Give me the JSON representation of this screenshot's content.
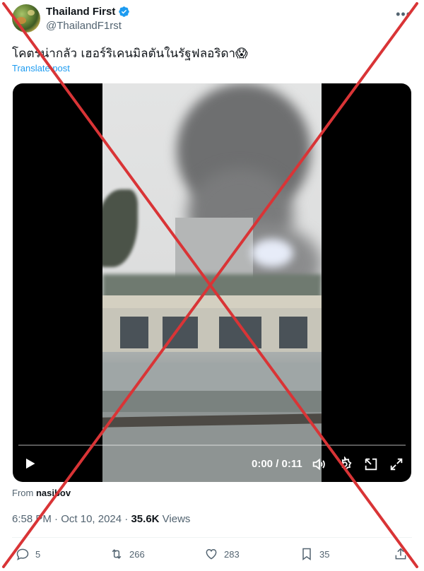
{
  "author": {
    "display_name": "Thailand First",
    "handle": "@ThailandF1rst"
  },
  "tweet": {
    "text": "โคตรน่ากลัว เฮอร์ริเคนมิลตันในรัฐฟลอริดา😱",
    "translate_label": "Translate post"
  },
  "video": {
    "time": "0:00 / 0:11"
  },
  "from": {
    "prefix": "From",
    "source": "nasibov"
  },
  "meta": {
    "time": "6:58 PM",
    "separator1": "·",
    "date": "Oct 10, 2024",
    "separator2": "·",
    "views_count": "35.6K",
    "views_label": "Views"
  },
  "actions": {
    "replies": "5",
    "reposts": "266",
    "likes": "283",
    "bookmarks": "35"
  },
  "colors": {
    "accent": "#1d9bf0",
    "cross": "#d93436"
  }
}
